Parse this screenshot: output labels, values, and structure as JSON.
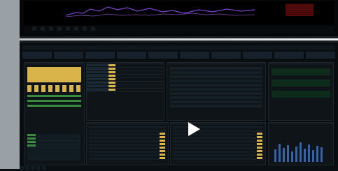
{
  "top": {
    "tabs": [
      "",
      "",
      "",
      "",
      "",
      "",
      "",
      ""
    ],
    "accent_color": "#7a41d1"
  },
  "bottom": {
    "tickers": [
      {
        "label": "",
        "up": ""
      },
      {
        "label": "",
        "up": ""
      },
      {
        "label": "",
        "up": ""
      },
      {
        "label": "",
        "up": ""
      },
      {
        "label": "",
        "up": ""
      },
      {
        "label": "",
        "up": ""
      },
      {
        "label": "",
        "up": ""
      },
      {
        "label": "",
        "up": ""
      },
      {
        "label": "",
        "up": ""
      },
      {
        "label": "",
        "up": ""
      }
    ],
    "panels": {
      "left_title": "",
      "center_title": "",
      "right_title": ""
    }
  },
  "overlay": {
    "play_icon": "play-icon"
  }
}
